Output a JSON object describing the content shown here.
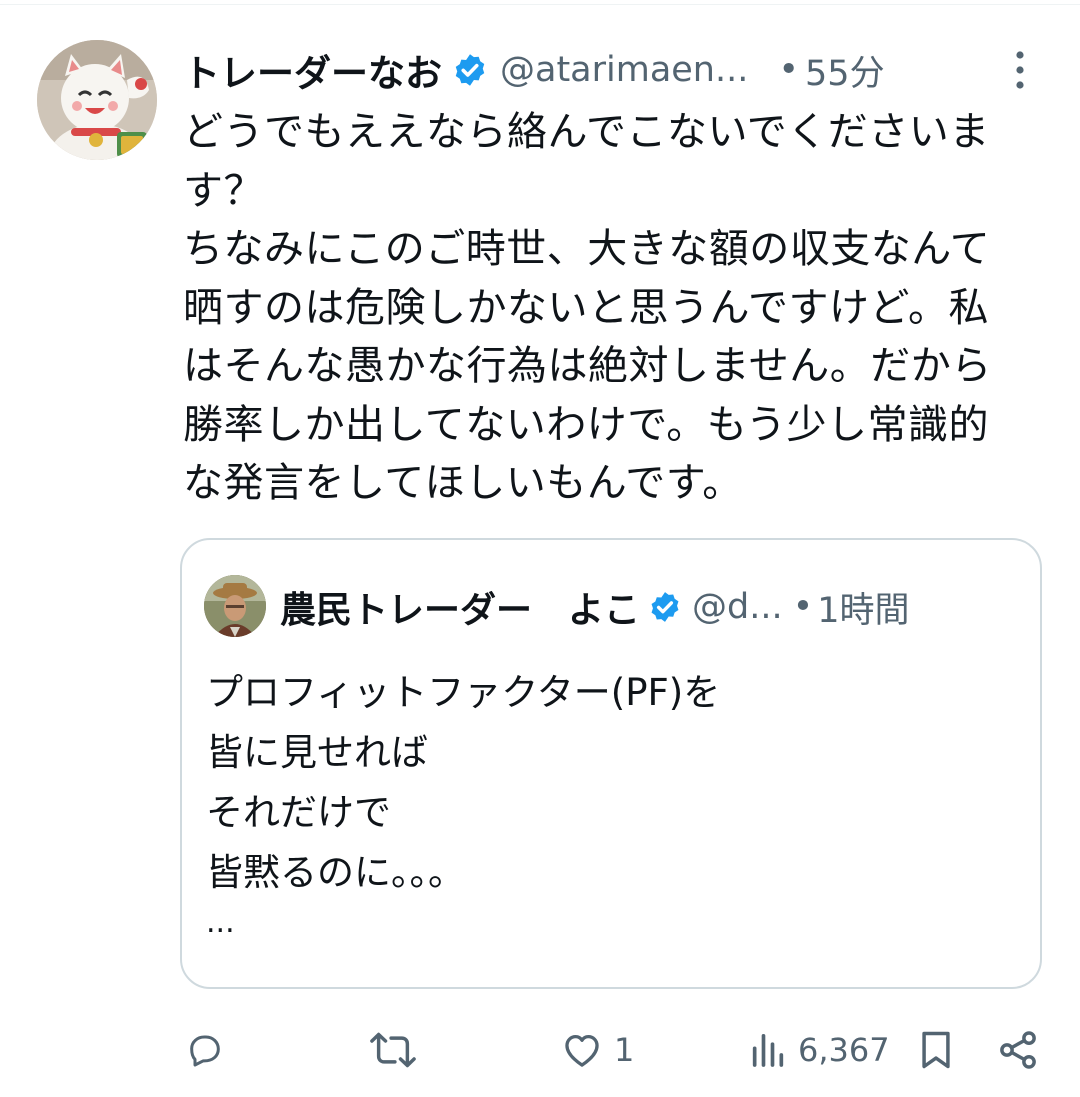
{
  "tweet": {
    "author_name": "トレーダーなお",
    "handle": "@atarimaen...",
    "separator": "•",
    "time": "55分",
    "text_lines": [
      "どうでもええなら絡んでこないでくださいま",
      "す？",
      "ちなみにこのご時世、大きな額の収支なんて",
      "晒すのは危険しかないと思うんですけど。私",
      "はそんな愚かな行為は絶対しません。だから",
      "勝率しか出してないわけで。もう少し常識的",
      "な発言をしてほしいもんです。"
    ]
  },
  "quote": {
    "author_name": "農民トレーダー　よこ",
    "handle": "@d...",
    "separator": "•",
    "time": "1時間",
    "text_lines": [
      "プロフィットファクター(PF)を",
      "皆に見せれば",
      "それだけで",
      "皆黙るのに。。。"
    ],
    "truncation": "..."
  },
  "actions": {
    "reply_count": "",
    "retweet_count": "",
    "like_count": "1",
    "view_count": "6,367"
  },
  "colors": {
    "text_primary": "#0f1419",
    "text_secondary": "#536471",
    "verified_blue": "#1d9bf0",
    "border": "#cfd9de"
  },
  "icons": {
    "verified": "verified-badge-icon",
    "more": "more-vertical-icon",
    "reply": "reply-icon",
    "retweet": "retweet-icon",
    "like": "heart-icon",
    "views": "views-icon",
    "bookmark": "bookmark-icon",
    "share": "share-icon"
  }
}
